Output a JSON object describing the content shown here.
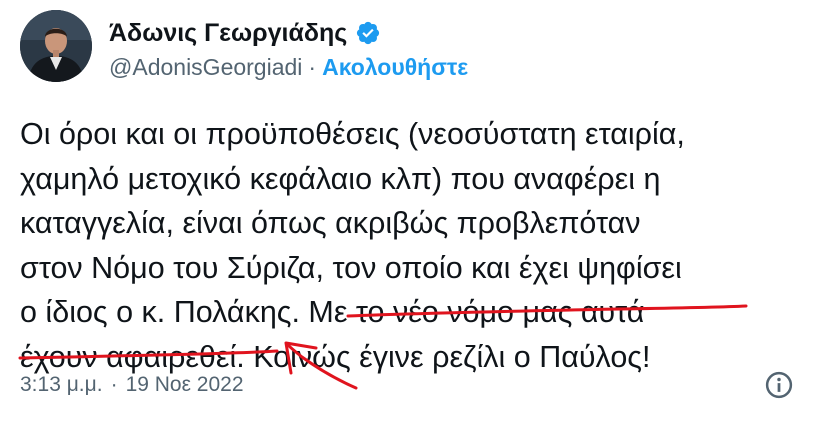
{
  "author": {
    "display_name": "Άδωνις Γεωργιάδης",
    "handle": "@AdonisGeorgiadi",
    "separator": "·",
    "follow_label": "Ακολουθήστε",
    "verified": true
  },
  "tweet": {
    "text": "Οι όροι και οι προϋποθέσεις (νεοσύστατη εταιρία,\nχαμηλό μετοχικό κεφάλαιο κλπ) που αναφέρει η\nκαταγγελία, είναι όπως ακριβώς προβλεπόταν\nστον Νόμο του Σύριζα, τον οποίο και έχει ψηφίσει\nο ίδιος ο κ. Πολάκης. Με το νέο νόμο μας αυτά\nέχουν αφαιρεθεί. Κοινώς έγινε ρεζίλι ο Παύλος!"
  },
  "meta": {
    "time": "3:13 μ.μ.",
    "separator": "·",
    "date": "19 Νοε 2022"
  },
  "colors": {
    "accent": "#1d9bf0",
    "secondary_text": "#536471",
    "annotation": "#e0141e"
  },
  "icons": {
    "verified": "verified-badge-icon",
    "info": "info-icon"
  }
}
